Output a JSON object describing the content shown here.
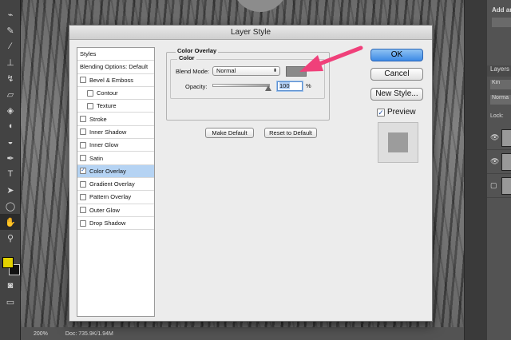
{
  "dialog": {
    "title": "Layer Style",
    "styles_list": {
      "header": "Styles",
      "blending_options": "Blending Options: Default",
      "items": [
        {
          "label": "Bevel & Emboss",
          "checked": false,
          "indent": false,
          "selected": false
        },
        {
          "label": "Contour",
          "checked": false,
          "indent": true,
          "selected": false
        },
        {
          "label": "Texture",
          "checked": false,
          "indent": true,
          "selected": false
        },
        {
          "label": "Stroke",
          "checked": false,
          "indent": false,
          "selected": false
        },
        {
          "label": "Inner Shadow",
          "checked": false,
          "indent": false,
          "selected": false
        },
        {
          "label": "Inner Glow",
          "checked": false,
          "indent": false,
          "selected": false
        },
        {
          "label": "Satin",
          "checked": false,
          "indent": false,
          "selected": false
        },
        {
          "label": "Color Overlay",
          "checked": true,
          "indent": false,
          "selected": true
        },
        {
          "label": "Gradient Overlay",
          "checked": false,
          "indent": false,
          "selected": false
        },
        {
          "label": "Pattern Overlay",
          "checked": false,
          "indent": false,
          "selected": false
        },
        {
          "label": "Outer Glow",
          "checked": false,
          "indent": false,
          "selected": false
        },
        {
          "label": "Drop Shadow",
          "checked": false,
          "indent": false,
          "selected": false
        }
      ]
    },
    "color_overlay": {
      "group_title": "Color Overlay",
      "sub_title": "Color",
      "blend_mode_label": "Blend Mode:",
      "blend_mode_value": "Normal",
      "overlay_color": "#8a8a8a",
      "opacity_label": "Opacity:",
      "opacity_value": "100",
      "opacity_unit": "%",
      "make_default": "Make Default",
      "reset_default": "Reset to Default"
    },
    "buttons": {
      "ok": "OK",
      "cancel": "Cancel",
      "new_style": "New Style...",
      "preview_label": "Preview",
      "preview_checked": true
    }
  },
  "statusbar": {
    "zoom": "200%",
    "doc": "Doc: 735.9K/1.94M"
  },
  "right_panel": {
    "add_anchor": "Add an",
    "kind": "Kin",
    "layers_tab": "Layers",
    "blend": "Norma",
    "lock": "Lock:"
  },
  "toolbar": {
    "tools": [
      "eyedropper-icon",
      "brush-icon",
      "healing-icon",
      "clone-stamp-icon",
      "history-brush-icon",
      "eraser-icon",
      "paint-bucket-icon",
      "blur-icon",
      "dodge-icon",
      "pen-icon",
      "type-icon",
      "path-select-icon",
      "ellipse-icon",
      "hand-icon",
      "zoom-icon"
    ],
    "fg_color": "#e3d200",
    "bg_color": "#111111"
  },
  "annotation": {
    "arrow_color": "#f0407a"
  }
}
